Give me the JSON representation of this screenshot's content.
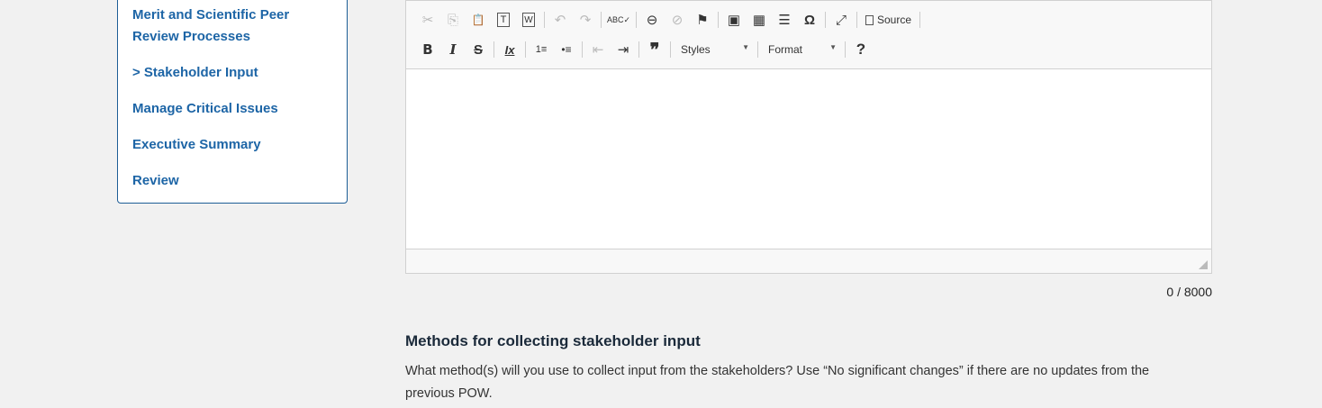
{
  "sidebar": {
    "items": [
      {
        "label": "Merit and Scientific Peer Review Processes"
      },
      {
        "label": "> Stakeholder Input"
      },
      {
        "label": "Manage Critical Issues"
      },
      {
        "label": "Executive Summary"
      },
      {
        "label": "Review"
      }
    ]
  },
  "editor": {
    "toolbar": {
      "source_label": "Source",
      "styles_label": "Styles",
      "format_label": "Format",
      "icons": {
        "cut": "✂",
        "copy": "⎘",
        "paste": "📋",
        "paste_text": "T",
        "paste_word": "W",
        "undo": "↶",
        "redo": "↷",
        "spell": "ABC✓",
        "link": "⊖",
        "unlink": "⊘",
        "anchor": "⚑",
        "image": "▣",
        "table": "▦",
        "hr": "☰",
        "special": "Ω",
        "max": "⤢",
        "bold": "B",
        "italic": "I",
        "strike": "S",
        "clear": "Ix",
        "ol": "1≡",
        "ul": "•≡",
        "outdent": "⇤",
        "indent": "⇥",
        "quote": "❞",
        "help": "?"
      }
    },
    "content": "",
    "counter": "0 / 8000"
  },
  "section": {
    "heading": "Methods for collecting stakeholder input",
    "text": "What method(s) will you use to collect input from the stakeholders? Use “No significant changes” if there are no updates from the previous POW."
  }
}
